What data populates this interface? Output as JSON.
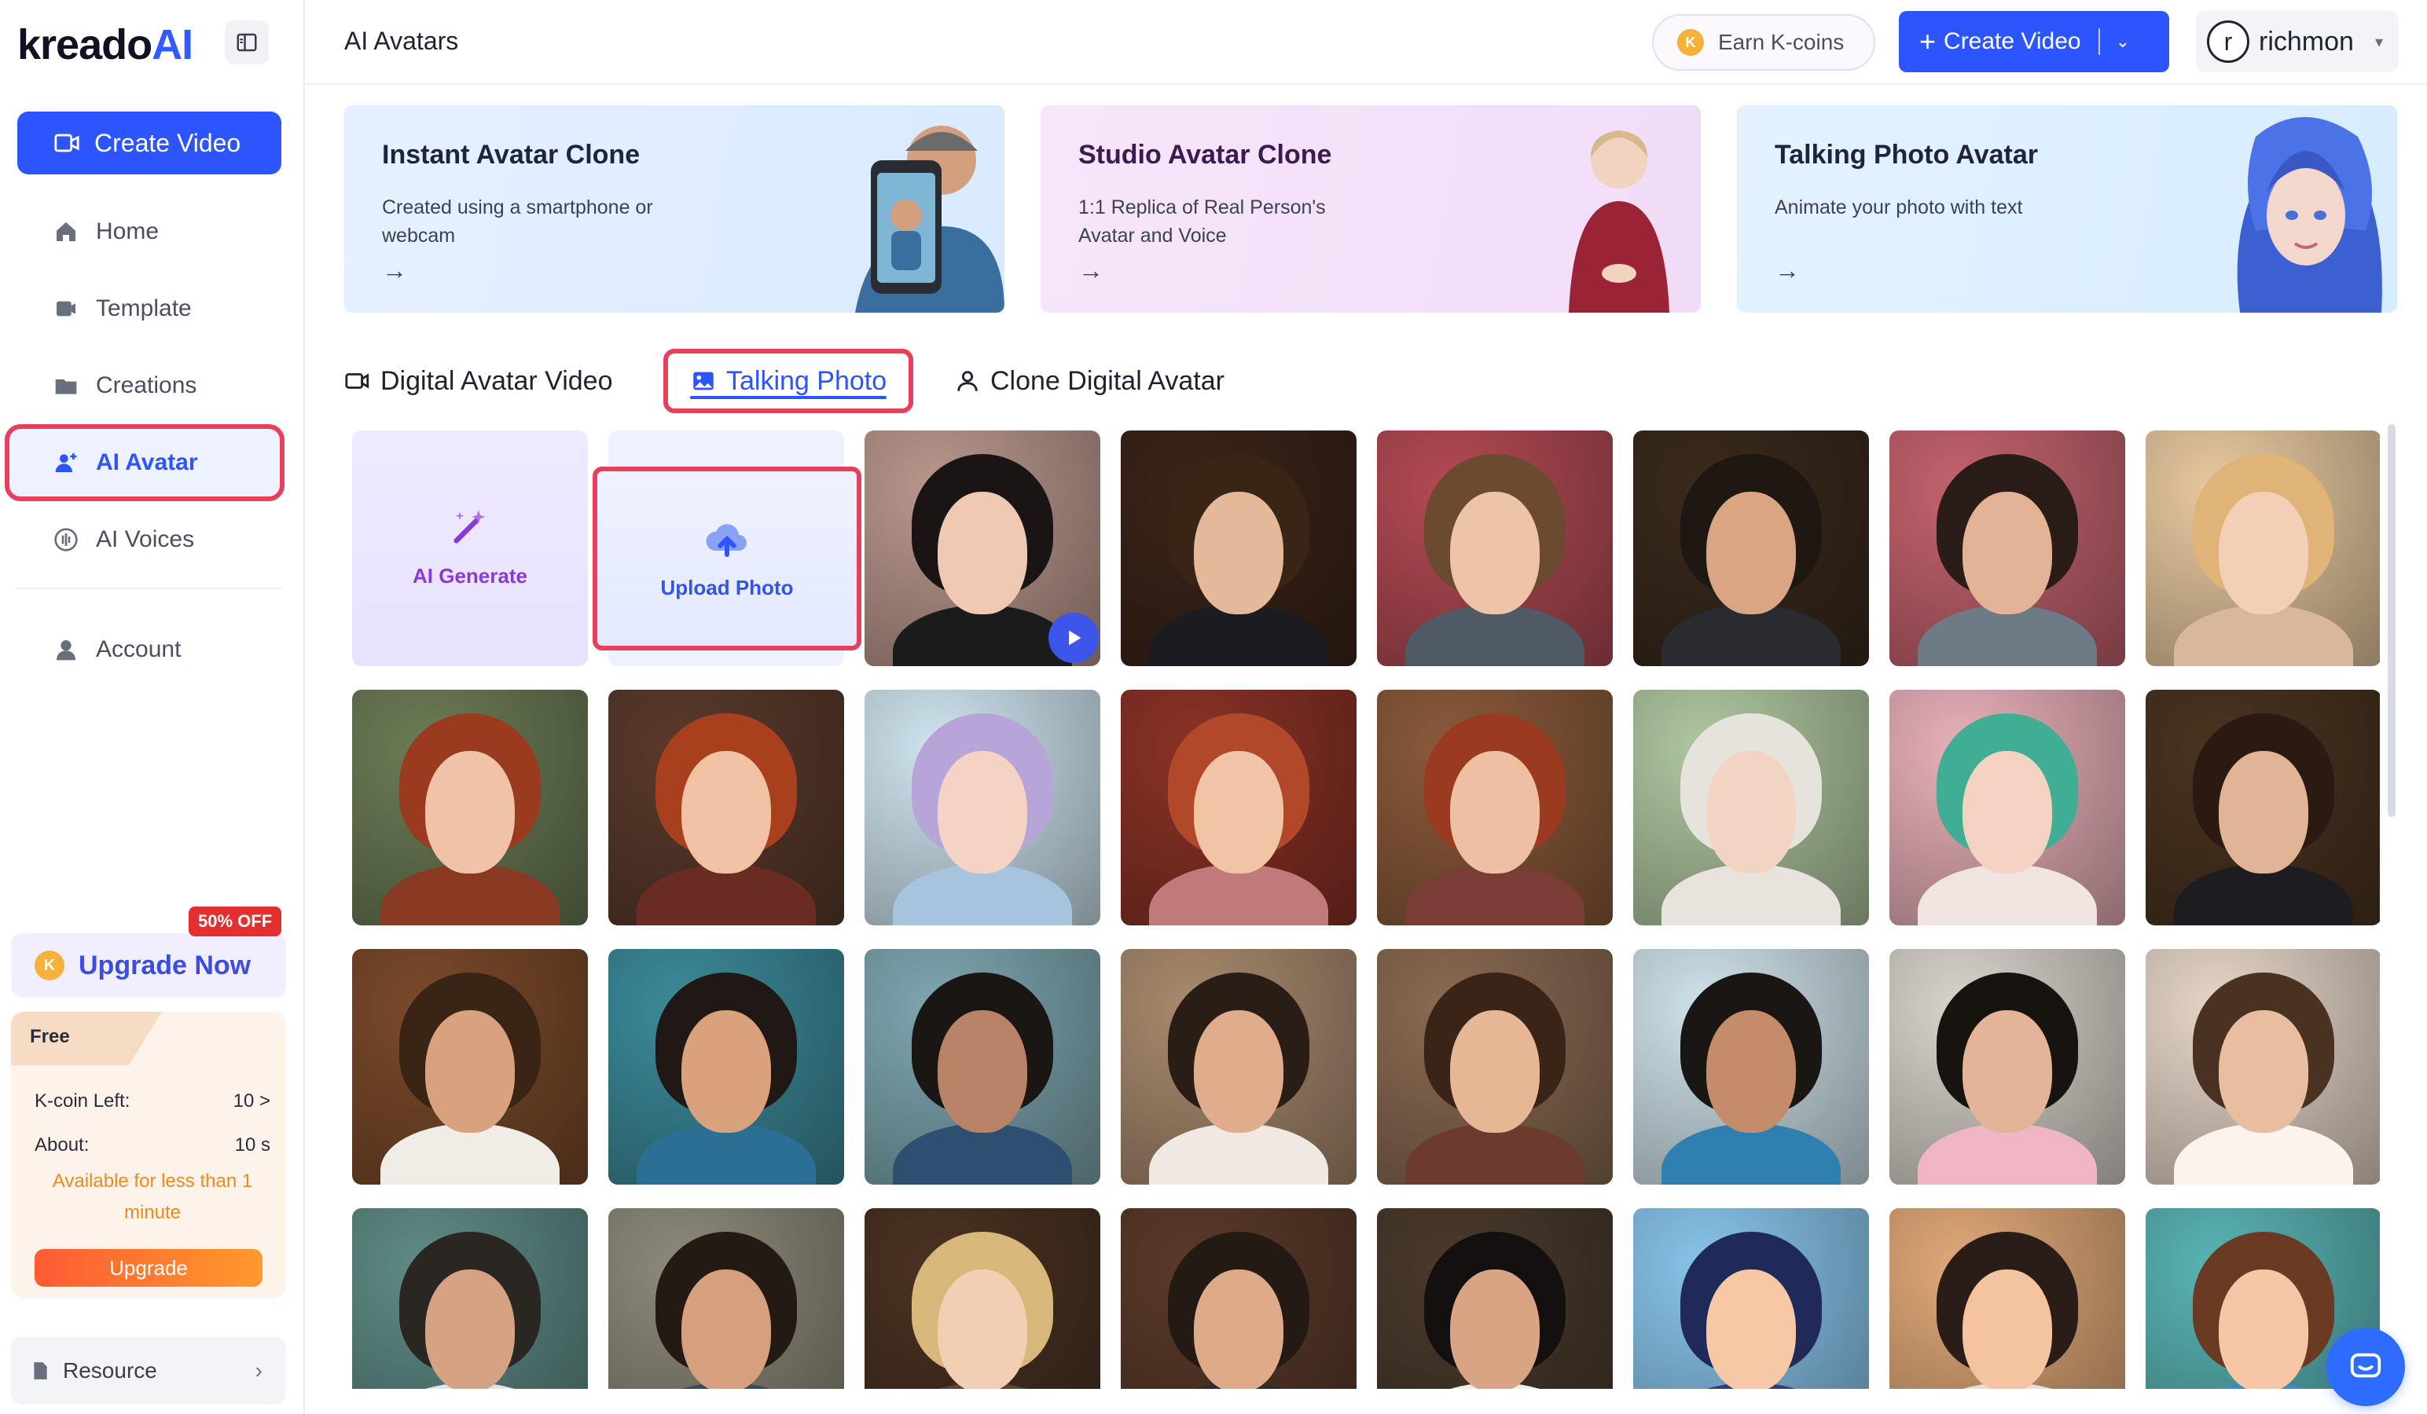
{
  "brand": {
    "logo_text": "kreado",
    "logo_ai": "AI"
  },
  "sidebar": {
    "create_label": "Create Video",
    "items": [
      {
        "label": "Home",
        "icon": "home-icon"
      },
      {
        "label": "Template",
        "icon": "template-icon"
      },
      {
        "label": "Creations",
        "icon": "folder-icon"
      },
      {
        "label": "AI Avatar",
        "icon": "user-icon",
        "active": true
      },
      {
        "label": "AI Voices",
        "icon": "voice-icon"
      },
      {
        "label": "Account",
        "icon": "account-icon"
      }
    ],
    "promo_badge": "50% OFF",
    "upgrade_now": "Upgrade Now",
    "plan": {
      "tier": "Free",
      "kcoin_label": "K-coin Left:",
      "kcoin_value": "10 >",
      "about_label": "About:",
      "about_value": "10 s",
      "note": "Available for less than 1 minute",
      "upgrade_button": "Upgrade"
    },
    "resource_label": "Resource"
  },
  "header": {
    "title": "AI Avatars",
    "earn_label": "Earn K-coins",
    "create_label": "Create Video",
    "user_initial": "r",
    "user_name": "richmon"
  },
  "features": [
    {
      "title": "Instant Avatar Clone",
      "desc": "Created using a smartphone or webcam",
      "arrow": "→"
    },
    {
      "title": "Studio Avatar Clone",
      "desc": "1:1 Replica of Real Person's Avatar and Voice",
      "arrow": "→"
    },
    {
      "title": "Talking Photo Avatar",
      "desc": "Animate your photo with text",
      "arrow": "→"
    }
  ],
  "tabs": [
    {
      "label": "Digital Avatar Video",
      "icon": "video-icon"
    },
    {
      "label": "Talking Photo",
      "icon": "image-icon",
      "active": true
    },
    {
      "label": "Clone Digital Avatar",
      "icon": "person-icon"
    }
  ],
  "grid": {
    "ai_generate_label": "AI Generate",
    "upload_label": "Upload Photo"
  },
  "colors": {
    "accent": "#2d55ff",
    "highlight": "#e8405c",
    "ai_purple": "#8a3ad8"
  }
}
